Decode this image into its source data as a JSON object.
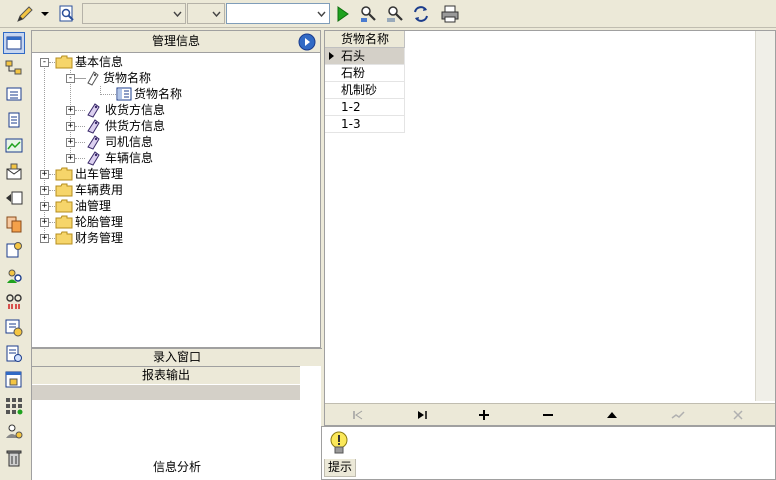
{
  "panel": {
    "title": "管理信息"
  },
  "tree": {
    "basic": "基本信息",
    "goods_group": "货物名称",
    "goods_item": "货物名称",
    "receiver": "收货方信息",
    "supplier": "供货方信息",
    "driver": "司机信息",
    "vehicle": "车辆信息",
    "dispatch": "出车管理",
    "vehicle_cost": "车辆费用",
    "oil": "油管理",
    "tire": "轮胎管理",
    "finance": "财务管理"
  },
  "sections": {
    "entry": "录入窗口",
    "report": "报表输出",
    "analysis": "信息分析"
  },
  "grid": {
    "column": "货物名称",
    "rows": [
      "石头",
      "石粉",
      "机制砂",
      "1-2",
      "1-3"
    ]
  },
  "hint": {
    "label": "提示"
  },
  "colors": {
    "accent": "#316ac5",
    "selected_row": "#d4d0c8",
    "run_green": "#1fa21f"
  }
}
